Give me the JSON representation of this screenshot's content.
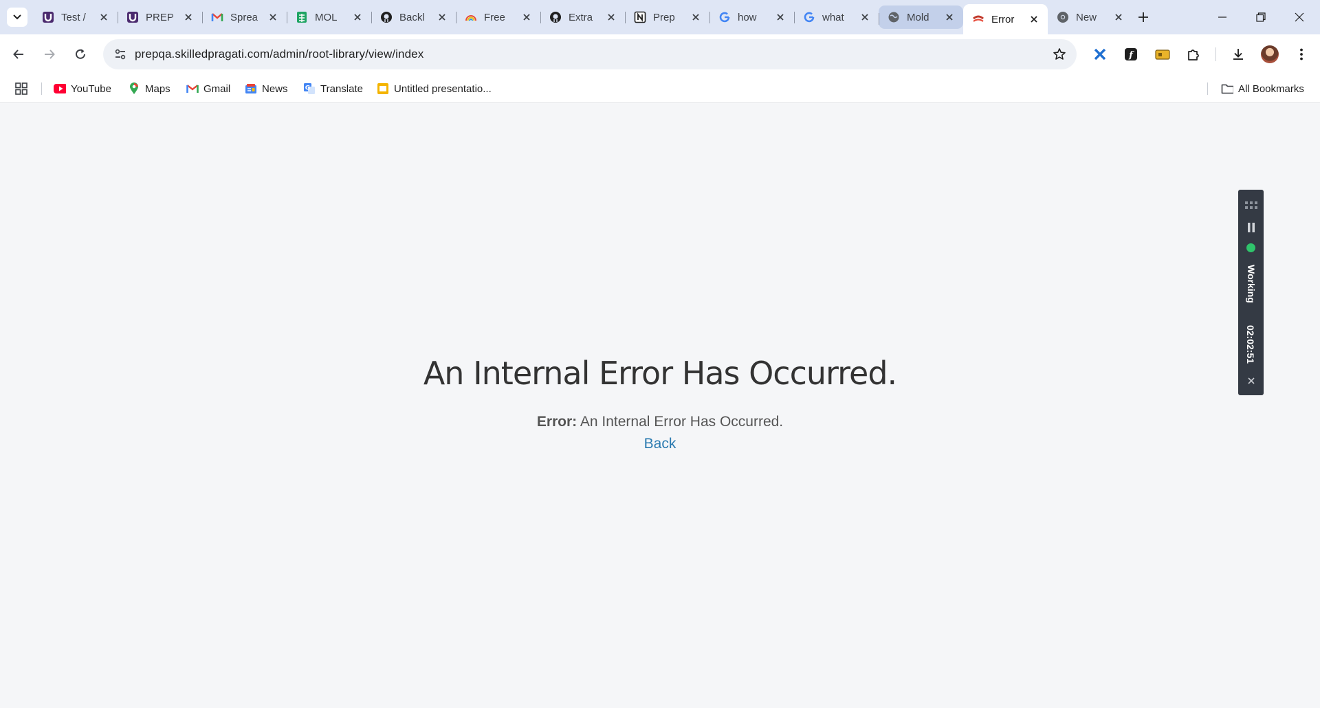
{
  "browser": {
    "tabs": [
      {
        "title": "Test /",
        "icon": "purple-u-icon"
      },
      {
        "title": "PREP",
        "icon": "purple-u-icon"
      },
      {
        "title": "Sprea",
        "icon": "gmail-icon"
      },
      {
        "title": "MOL",
        "icon": "sheets-icon"
      },
      {
        "title": "Backl",
        "icon": "github-icon"
      },
      {
        "title": "Free",
        "icon": "rainbow-icon"
      },
      {
        "title": "Extra",
        "icon": "github-icon"
      },
      {
        "title": "Prep",
        "icon": "notion-icon"
      },
      {
        "title": "how",
        "icon": "google-icon"
      },
      {
        "title": "what",
        "icon": "google-icon"
      },
      {
        "title": "Mold",
        "icon": "globe-icon"
      },
      {
        "title": "Error",
        "icon": "error-favicon-icon"
      },
      {
        "title": "New",
        "icon": "chrome-icon"
      }
    ],
    "active_tab_index": 11,
    "hover_tab_index": 10,
    "url": "prepqa.skilledpragati.com/admin/root-library/view/index",
    "bookmarks": [
      {
        "label": "YouTube",
        "icon": "youtube-icon"
      },
      {
        "label": "Maps",
        "icon": "maps-icon"
      },
      {
        "label": "Gmail",
        "icon": "gmail-icon"
      },
      {
        "label": "News",
        "icon": "news-icon"
      },
      {
        "label": "Translate",
        "icon": "translate-icon"
      },
      {
        "label": "Untitled presentatio...",
        "icon": "slides-icon"
      }
    ],
    "all_bookmarks_label": "All Bookmarks"
  },
  "page": {
    "title": "An Internal Error Has Occurred.",
    "error_label": "Error:",
    "error_message": "An Internal Error Has Occurred.",
    "back_link": "Back"
  },
  "timer_widget": {
    "status": "Working",
    "time": "02:02:51",
    "status_color": "#2fc46b"
  },
  "colors": {
    "link": "#2a7ab0",
    "tabstrip": "#dfe6f5",
    "page_bg": "#f5f6f8"
  }
}
